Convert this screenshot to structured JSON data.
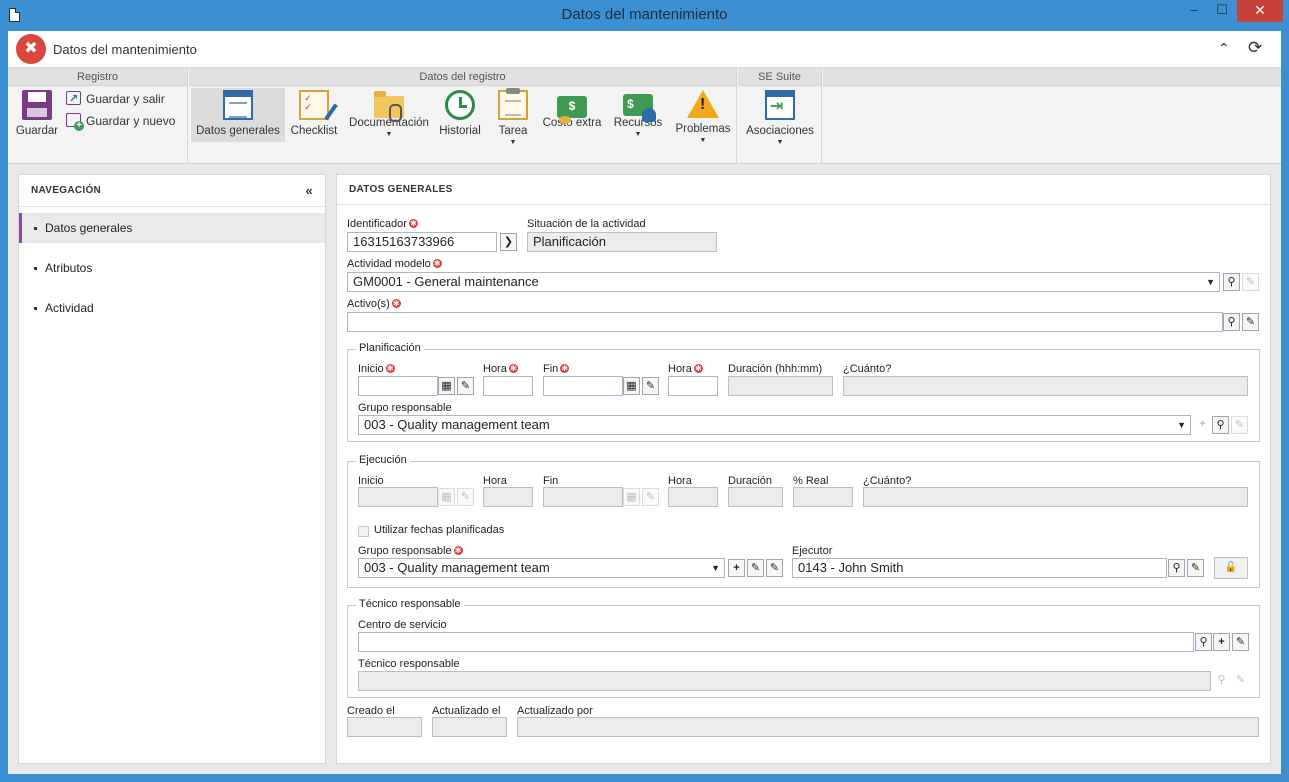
{
  "window": {
    "title": "Datos del mantenimiento",
    "minimize": "‒",
    "maximize": "☐",
    "close": "✕"
  },
  "app": {
    "title": "Datos del mantenimiento",
    "collapse_icon": "⌃",
    "refresh_icon": "⟳"
  },
  "ribbon": {
    "groups": {
      "registro": "Registro",
      "datos": "Datos del registro",
      "suite": "SE Suite"
    },
    "save": "Guardar",
    "save_exit": "Guardar y salir",
    "save_new": "Guardar y nuevo",
    "buttons": {
      "general": "Datos generales",
      "checklist": "Checklist",
      "documentation": "Documentación",
      "history": "Historial",
      "task": "Tarea",
      "extra_cost": "Costo extra",
      "resources": "Recursos",
      "problems": "Problemas",
      "associations": "Asociaciones"
    },
    "arrow": "▼"
  },
  "nav": {
    "header": "NAVEGACIÓN",
    "collapse": "«",
    "items": [
      "Datos generales",
      "Atributos",
      "Actividad"
    ],
    "active_index": 0
  },
  "main": {
    "header": "DATOS GENERALES",
    "identificador": {
      "label": "Identificador",
      "value": "16315163733966"
    },
    "situacion": {
      "label": "Situación de la actividad",
      "value": "Planificación"
    },
    "actividad_modelo": {
      "label": "Actividad modelo",
      "value": "GM0001 - General maintenance"
    },
    "activos": {
      "label": "Activo(s)",
      "value": ""
    },
    "planificacion": {
      "title": "Planificación",
      "inicio": "Inicio",
      "hora1": "Hora",
      "fin": "Fin",
      "hora2": "Hora",
      "duracion": "Duración (hhh:mm)",
      "cuanto": "¿Cuánto?",
      "grupo_label": "Grupo responsable",
      "grupo_value": "003 - Quality management team"
    },
    "ejecucion": {
      "title": "Ejecución",
      "inicio": "Inicio",
      "hora1": "Hora",
      "fin": "Fin",
      "hora2": "Hora",
      "duracion": "Duración",
      "real": "% Real",
      "cuanto": "¿Cuánto?",
      "utilizar": "Utilizar fechas planificadas",
      "grupo_label": "Grupo responsable",
      "grupo_value": "003 - Quality management team",
      "ejecutor_label": "Ejecutor",
      "ejecutor_value": "0143 - John Smith"
    },
    "tecnico": {
      "title": "Técnico responsable",
      "centro_label": "Centro de servicio",
      "tecnico_label": "Técnico responsable"
    },
    "footer": {
      "creado": "Creado el",
      "actualizado": "Actualizado el",
      "actualizado_por": "Actualizado por"
    },
    "required_mark": "✱",
    "icons": {
      "arrow_right": "❯",
      "binoculars": "⚲",
      "eraser": "✎",
      "search": "⚲",
      "calendar": "▦",
      "plus": "+",
      "pencil": "✎",
      "lock": "🔓"
    }
  },
  "colors": {
    "accent": "#8b4b9e",
    "title_bar": "#3c8fd0",
    "required": "#e23c3c"
  }
}
